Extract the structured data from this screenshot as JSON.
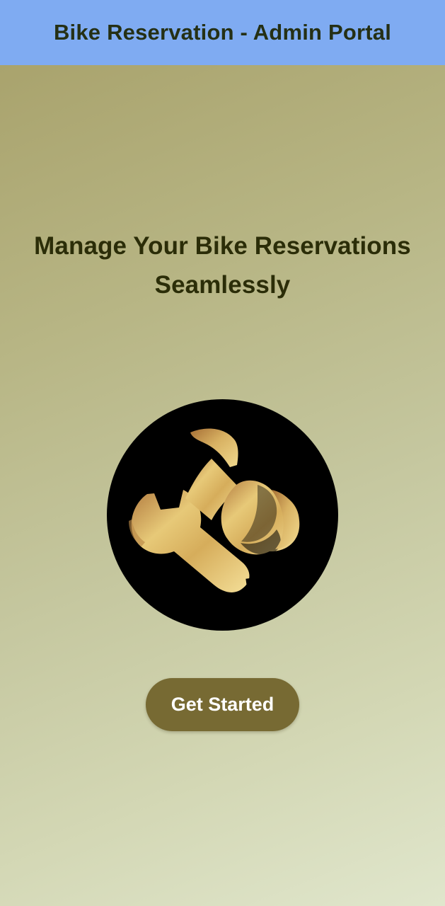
{
  "app_bar": {
    "title": "Bike Reservation - Admin Portal",
    "background": "#7fabf2",
    "text_color": "#253015"
  },
  "hero": {
    "headline": "Manage Your Bike Reservations Seamlessly",
    "icon_name": "wrench-and-helmet-icon",
    "icon_color": "#d6ad5b",
    "circle_color": "#000000"
  },
  "actions": {
    "get_started": "Get Started",
    "button_color": "#776a33",
    "button_text_color": "#ffffff"
  }
}
